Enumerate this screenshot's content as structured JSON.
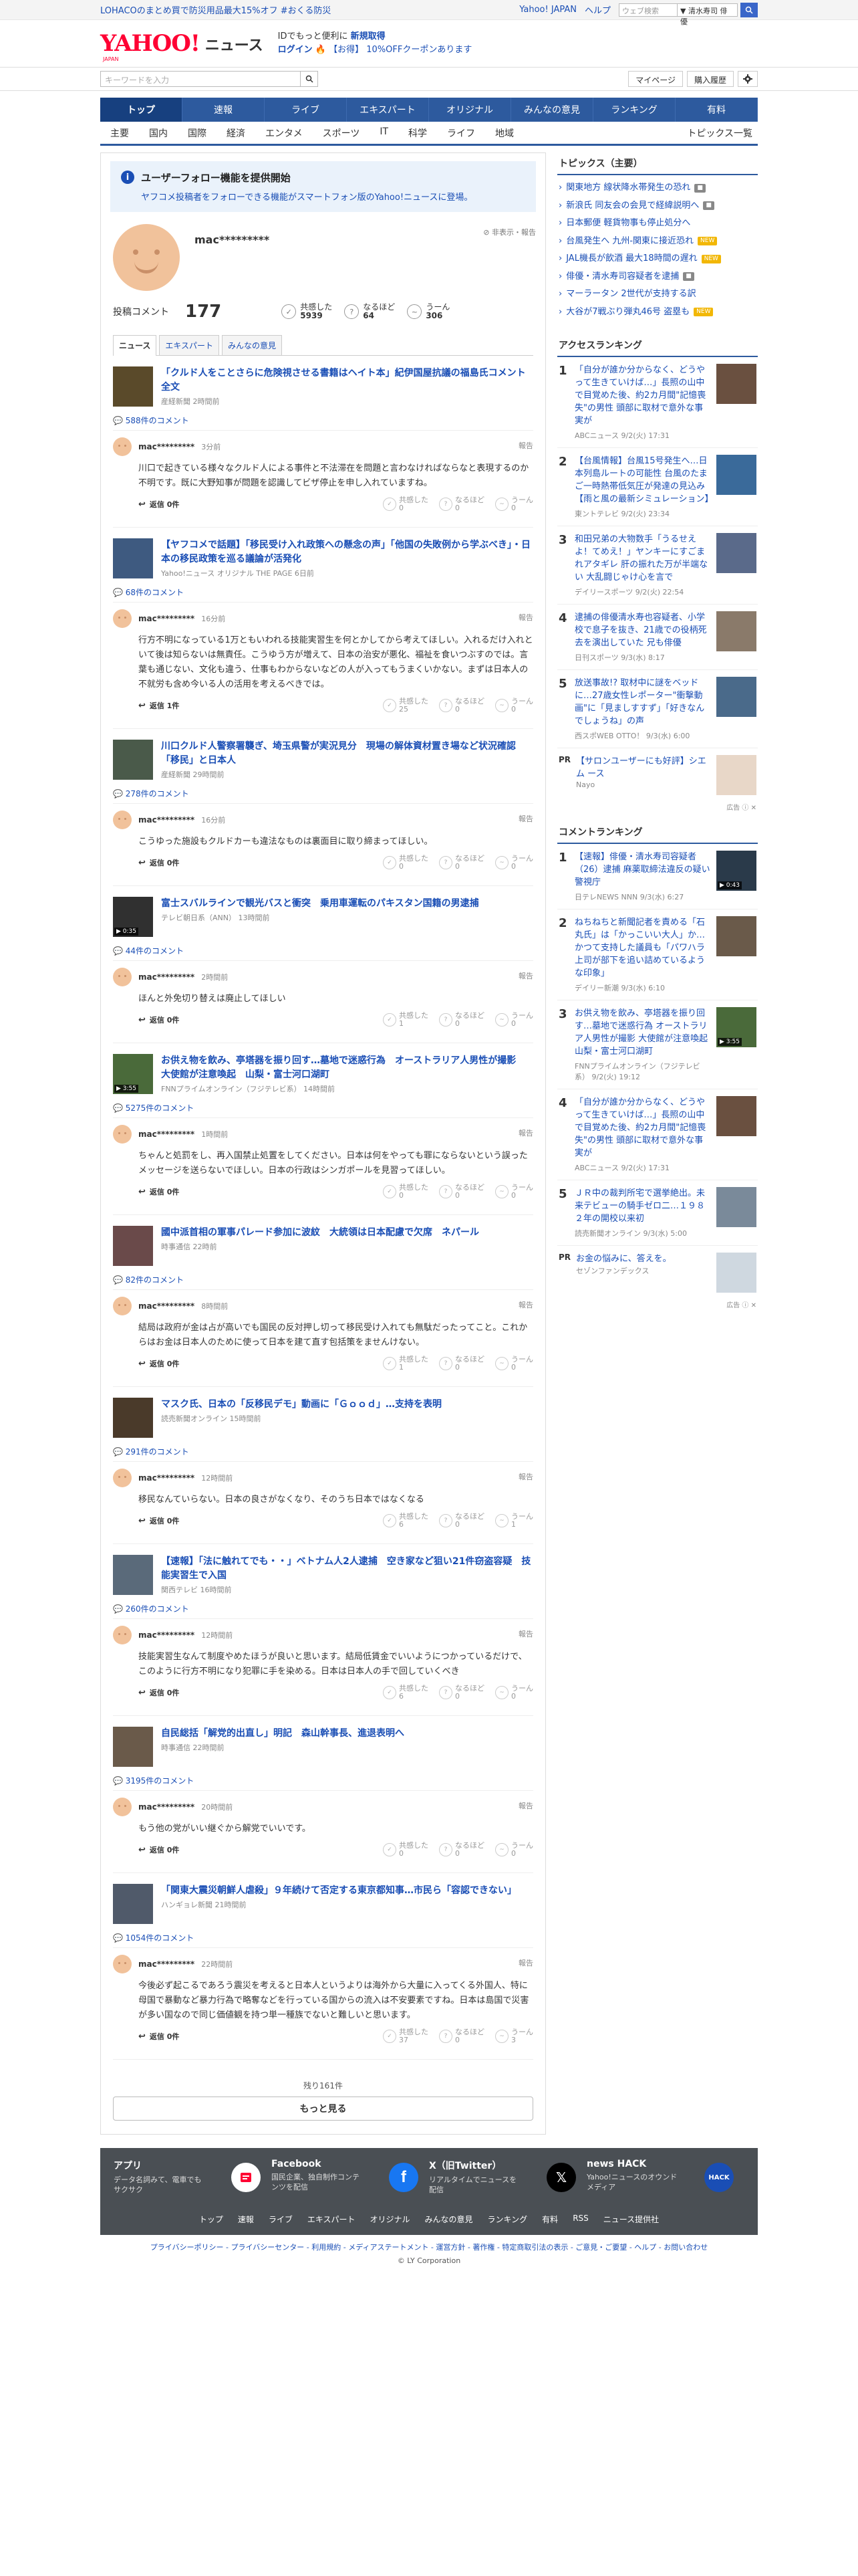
{
  "topbar": {
    "promo": "LOHACOのまとめ買で防災用品最大15%オフ #おくる防災",
    "yahoo_link": "Yahoo! JAPAN",
    "help": "ヘルプ",
    "search_placeholder": "ウェブ検索",
    "search_scope": "▼ 清水寿司 俳優"
  },
  "logo": {
    "yahoo": "YAHOO!",
    "japan": "JAPAN",
    "news": "ニュース"
  },
  "logo_text": {
    "line1": "IDでもっと便利に",
    "line1_bold": "新規取得",
    "login": "ログイン",
    "coupon": "【お得】 10%OFFクーポンあります"
  },
  "search": {
    "placeholder": "キーワードを入力",
    "mypage": "マイページ",
    "history": "購入履歴"
  },
  "nav": [
    {
      "label": "トップ",
      "active": true
    },
    {
      "label": "速報"
    },
    {
      "label": "ライブ"
    },
    {
      "label": "エキスパート"
    },
    {
      "label": "オリジナル"
    },
    {
      "label": "みんなの意見"
    },
    {
      "label": "ランキング"
    },
    {
      "label": "有料"
    }
  ],
  "subnav": [
    "主要",
    "国内",
    "国際",
    "経済",
    "エンタメ",
    "スポーツ",
    "IT",
    "科学",
    "ライフ",
    "地域"
  ],
  "subnav_all": "トピックス一覧",
  "notice": {
    "title": "ユーザーフォロー機能を提供開始",
    "desc": "ヤフコメ投稿者をフォローできる機能がスマートフォン版のYahoo!ニュースに登場。"
  },
  "profile": {
    "name": "mac*********",
    "report": "非表示・報告",
    "comments_label": "投稿コメント",
    "comments_count": "177",
    "reactions": [
      {
        "label": "共感した",
        "value": "5939"
      },
      {
        "label": "なるほど",
        "value": "64"
      },
      {
        "label": "うーん",
        "value": "306"
      }
    ]
  },
  "tabs": [
    "ニュース",
    "エキスパート",
    "みんなの意見"
  ],
  "vote_labels": [
    "共感した",
    "なるほど",
    "うーん"
  ],
  "reply_label": "返信",
  "report_label": "報告",
  "articles": [
    {
      "title": "「クルド人をことさらに危険視させる書籍はヘイト本」紀伊国屋抗議の福島氏コメント全文",
      "source": "産経新聞 2時間前",
      "count": "588件のコメント",
      "user": "mac*********",
      "time": "3分前",
      "text": "川口で起きている様々なクルド人による事件と不法滞在を問題と言わなければならなと表現するのか不明です。既に大野知事が問題を認識してビザ停止を申し入れていますね。",
      "reply": "返信 0件",
      "votes": [
        "0",
        "0",
        "0"
      ],
      "thumb": "#5a4a2a"
    },
    {
      "title": "【ヤフコメで話題】「移民受け入れ政策への懸念の声」「他国の失敗例から学ぶべき」・日本の移民政策を巡る議論が活発化",
      "source": "Yahoo!ニュース オリジナル THE PAGE 6日前",
      "count": "68件のコメント",
      "user": "mac*********",
      "time": "16分前",
      "text": "行方不明になっている1万ともいわれる技能実習生を何とかしてから考えてほしい。入れるだけ入れといて後は知らないは無責任。こうゆう方が増えて、日本の治安が悪化、福祉を食いつぶすのでは。言葉も通じない、文化も違う、仕事もわからないなどの人が入ってもうまくいかない。まずは日本人の不就労も含め今いる人の活用を考えるべきでは。",
      "reply": "返信 1件",
      "votes": [
        "25",
        "0",
        "0"
      ],
      "thumb": "#3e5a80"
    },
    {
      "title": "川口クルド人警察署襲ぎ、埼玉県警が実況見分　現場の解体資材置き場など状況確認「移民」と日本人",
      "source": "産経新聞 29時間前",
      "count": "278件のコメント",
      "user": "mac*********",
      "time": "16分前",
      "text": "こうゆった施設もクルドカーも違法なものは裏面目に取り締まってほしい。",
      "reply": "返信 0件",
      "votes": [
        "0",
        "0",
        "0"
      ],
      "thumb": "#4a5a4a"
    },
    {
      "title": "富士スバルラインで観光バスと衝突　乗用車運転のパキスタン国籍の男逮捕",
      "source": "テレビ朝日系（ANN） 13時間前",
      "count": "44件のコメント",
      "user": "mac*********",
      "time": "2時間前",
      "text": "ほんと外免切り替えは廃止してほしい",
      "reply": "返信 0件",
      "votes": [
        "1",
        "0",
        "0"
      ],
      "thumb": "#303030",
      "dur": "▶ 0:35"
    },
    {
      "title": "お供え物を飲み、亭塔器を振り回す…墓地で迷惑行為　オーストラリア人男性が撮影　大使館が注意喚起　山梨・富士河口湖町",
      "source": "FNNプライムオンライン（フジテレビ系） 14時間前",
      "count": "5275件のコメント",
      "user": "mac*********",
      "time": "1時間前",
      "text": "ちゃんと処罰をし、再入国禁止処置をしてください。日本は何をやっても罪にならないという誤ったメッセージを送らないでほしい。日本の行政はシンガポールを見習ってほしい。",
      "reply": "返信 0件",
      "votes": [
        "0",
        "0",
        "0"
      ],
      "thumb": "#4a6a3a",
      "dur": "▶ 3:55"
    },
    {
      "title": "國中派首相の軍事パレード参加に波紋　大統領は日本配慮で欠席　ネパール",
      "source": "時事通信 22時前",
      "count": "82件のコメント",
      "user": "mac*********",
      "time": "8時間前",
      "text": "結局は政府が金は占が高いでも国民の反対押し切って移民受け入れても無駄だったってこと。これからはお金は日本人のために使って日本を建て直す包括策をませんけない。",
      "reply": "返信 0件",
      "votes": [
        "1",
        "0",
        "0"
      ],
      "thumb": "#6a4a4a"
    },
    {
      "title": "マスク氏、日本の「反移民デモ」動画に「Ｇｏｏｄ」…支持を表明",
      "source": "読売新聞オンライン 15時間前",
      "count": "291件のコメント",
      "user": "mac*********",
      "time": "12時間前",
      "text": "移民なんていらない。日本の良さがなくなり、そのうち日本ではなくなる",
      "reply": "返信 0件",
      "votes": [
        "6",
        "0",
        "1"
      ],
      "thumb": "#4a3a2a"
    },
    {
      "title": "【速報】「法に触れてでも・・」ベトナム人2人逮捕　空き家など狙い21件窃盗容疑　技能実習生で入国",
      "source": "関西テレビ 16時間前",
      "count": "260件のコメント",
      "user": "mac*********",
      "time": "12時間前",
      "text": "技能実習生なんて制度やめたほうが良いと思います。結局低賃金でいいようにつかっているだけで、このように行方不明になり犯罪に手を染める。日本は日本人の手で回していくべき",
      "reply": "返信 0件",
      "votes": [
        "6",
        "0",
        "0"
      ],
      "thumb": "#5a6a7a"
    },
    {
      "title": "自民総括「解党的出直し」明記　森山幹事長、進退表明へ",
      "source": "時事通信 22時間前",
      "count": "3195件のコメント",
      "user": "mac*********",
      "time": "20時間前",
      "text": "もう他の党がいい継ぐから解党でいいです。",
      "reply": "返信 0件",
      "votes": [
        "0",
        "0",
        "0"
      ],
      "thumb": "#6a5a4a"
    },
    {
      "title": "「関東大震災朝鮮人虐殺」９年続けて否定する東京都知事…市民ら「容認できない」",
      "source": "ハンギョレ新聞 21時間前",
      "count": "1054件のコメント",
      "user": "mac*********",
      "time": "22時間前",
      "text": "今後必ず起こるであろう震災を考えると日本人というよりは海外から大量に入ってくる外国人、特に母国で暴動など暴力行為で略奪などを行っている国からの流入は不安要素ですね。日本は島国で災害が多い国なので同じ価値観を持つ単一種族でないと難しいと思います。",
      "reply": "返信 0件",
      "votes": [
        "37",
        "0",
        "3"
      ],
      "thumb": "#505a6a"
    }
  ],
  "more": {
    "remaining": "残り161件",
    "button": "もっと見る"
  },
  "sidebar": {
    "topics_title": "トピックス（主要）",
    "topics": [
      {
        "t": "関東地方 線状降水帯発生の恐れ",
        "tag": "img"
      },
      {
        "t": "新浪氏 同友会の会見で経緯説明へ",
        "tag": "img"
      },
      {
        "t": "日本郵便 軽貨物事も停止処分へ",
        "tag": ""
      },
      {
        "t": "台風発生へ 九州-関東に接近恐れ",
        "tag": "new"
      },
      {
        "t": "JAL機長が飲酒 最大18時間の遅れ",
        "tag": "new"
      },
      {
        "t": "俳優・清水寿司容疑者を逮捕",
        "tag": "img"
      },
      {
        "t": "マーラータン 2世代が支持する訳",
        "tag": ""
      },
      {
        "t": "大谷が7戦ぶり弾丸46号 盗塁も",
        "tag": "new"
      }
    ],
    "access_title": "アクセスランキング",
    "access": [
      {
        "n": "1",
        "t": "「自分が誰か分からなく、どうやって生きていけば…」長照の山中で目覚めた後、約2カ月間\"記憶喪失\"の男性 頭部に取材で意外な事実が",
        "s": "ABCニュース 9/2(火) 17:31",
        "c": "#6a5040"
      },
      {
        "n": "2",
        "t": "【台風情報】台風15号発生へ…日本列島ルートの可能性 台風のたまご一時熱帯低気圧が発達の見込み【雨と風の最新シミュレーション】",
        "s": "東ントテレビ 9/2(火) 23:34",
        "c": "#3a6a9a"
      },
      {
        "n": "3",
        "t": "和田兄弟の大物数手「うるせえよ！てめえ！」ヤンキーにすごまれアタギレ 肝の振れた万が半端ない 大乱闘じゃけ心を言で",
        "s": "デイリースポーツ 9/2(火) 22:54",
        "c": "#5a6a8a"
      },
      {
        "n": "4",
        "t": "逮捕の俳優清水寿也容疑者、小学校で息子を抜き、21歳での役柄死去を演出していた 兄も俳優",
        "s": "日刊スポーツ 9/3(水) 8:17",
        "c": "#8a7a6a"
      },
      {
        "n": "5",
        "t": "放送事故!? 取材中に謎をベッドに…27歳女性レポーター\"衝撃動画\"に「見ましすすず」「好きなんでしょうね」の声",
        "s": "西スポWEB OTTO！ 9/3(水) 6:00",
        "c": "#4a6a8a"
      }
    ],
    "pr1": {
      "label": "PR",
      "t": "【サロンユーザーにも好評】シエ ム ース",
      "s": "Nayo",
      "ad": "広告 ⓘ ✕"
    },
    "comment_title": "コメントランキング",
    "comment": [
      {
        "n": "1",
        "t": "【速報】俳優・清水寿司容疑者（26）逮捕 麻薬取締法違反の疑い警視庁",
        "s": "日テレNEWS NNN 9/3(水) 6:27",
        "c": "#2a3a4a",
        "dur": "▶ 0:43"
      },
      {
        "n": "2",
        "t": "ねちねちと新聞記者を責める「石丸氏」は「かっこいい大人」か…かつて支持した議員も「パワハラ上司が部下を追い詰めているような印象」",
        "s": "デイリー新潮 9/3(水) 6:10",
        "c": "#6a5a4a"
      },
      {
        "n": "3",
        "t": "お供え物を飲み、亭塔器を振り回す…墓地で迷惑行為 オーストラリア人男性が撮影 大使館が注意喚起 山梨・富士河口湖町",
        "s": "FNNプライムオンライン（フジテレビ系） 9/2(火) 19:12",
        "c": "#4a6a3a",
        "dur": "▶ 3:55"
      },
      {
        "n": "4",
        "t": "「自分が誰か分からなく、どうやって生きていけば…」長照の山中で目覚めた後、約2カ月間\"記憶喪失\"の男性 頭部に取材で意外な事実が",
        "s": "ABCニュース 9/2(火) 17:31",
        "c": "#6a5040"
      },
      {
        "n": "5",
        "t": "ＪＲ中の裁判所宅で選挙絶出。未来テビューの騎手ゼロ二…１９８２年の開校以来初",
        "s": "読売新聞オンライン 9/3(水) 5:00",
        "c": "#7a8a9a"
      }
    ],
    "pr2": {
      "label": "PR",
      "t": "お金の悩みに、答えを。",
      "s": "セゾンファンデックス",
      "ad": "広告 ⓘ ✕"
    }
  },
  "footer": {
    "cols": [
      {
        "t": "アプリ",
        "d": "データ名詞みて、電車でもサクサク"
      },
      {
        "t": "Facebook",
        "d": "国民企業、独自制作コンテンツを配信"
      },
      {
        "t": "X（旧Twitter）",
        "d": "リアルタイムでニュースを配信"
      },
      {
        "t": "news HACK",
        "d": "Yahoo!ニュースのオウンドメディア"
      }
    ],
    "hack_icon": "HACK",
    "links": [
      "トップ",
      "速報",
      "ライブ",
      "エキスパート",
      "オリジナル",
      "みんなの意見",
      "ランキング",
      "有料",
      "RSS",
      "ニュース提供社"
    ],
    "bottom": "プライバシーポリシー - プライバシーセンター - 利用規約 - メディアステートメント - 運営方針 - 著作権 - 特定商取引法の表示 - ご意見・ご要望 - ヘルプ - お問い合わせ",
    "copy": "© LY Corporation"
  },
  "colors": {
    "accent": "#2d5a9e",
    "link": "#1a4eb5",
    "brand": "#ff0033"
  }
}
